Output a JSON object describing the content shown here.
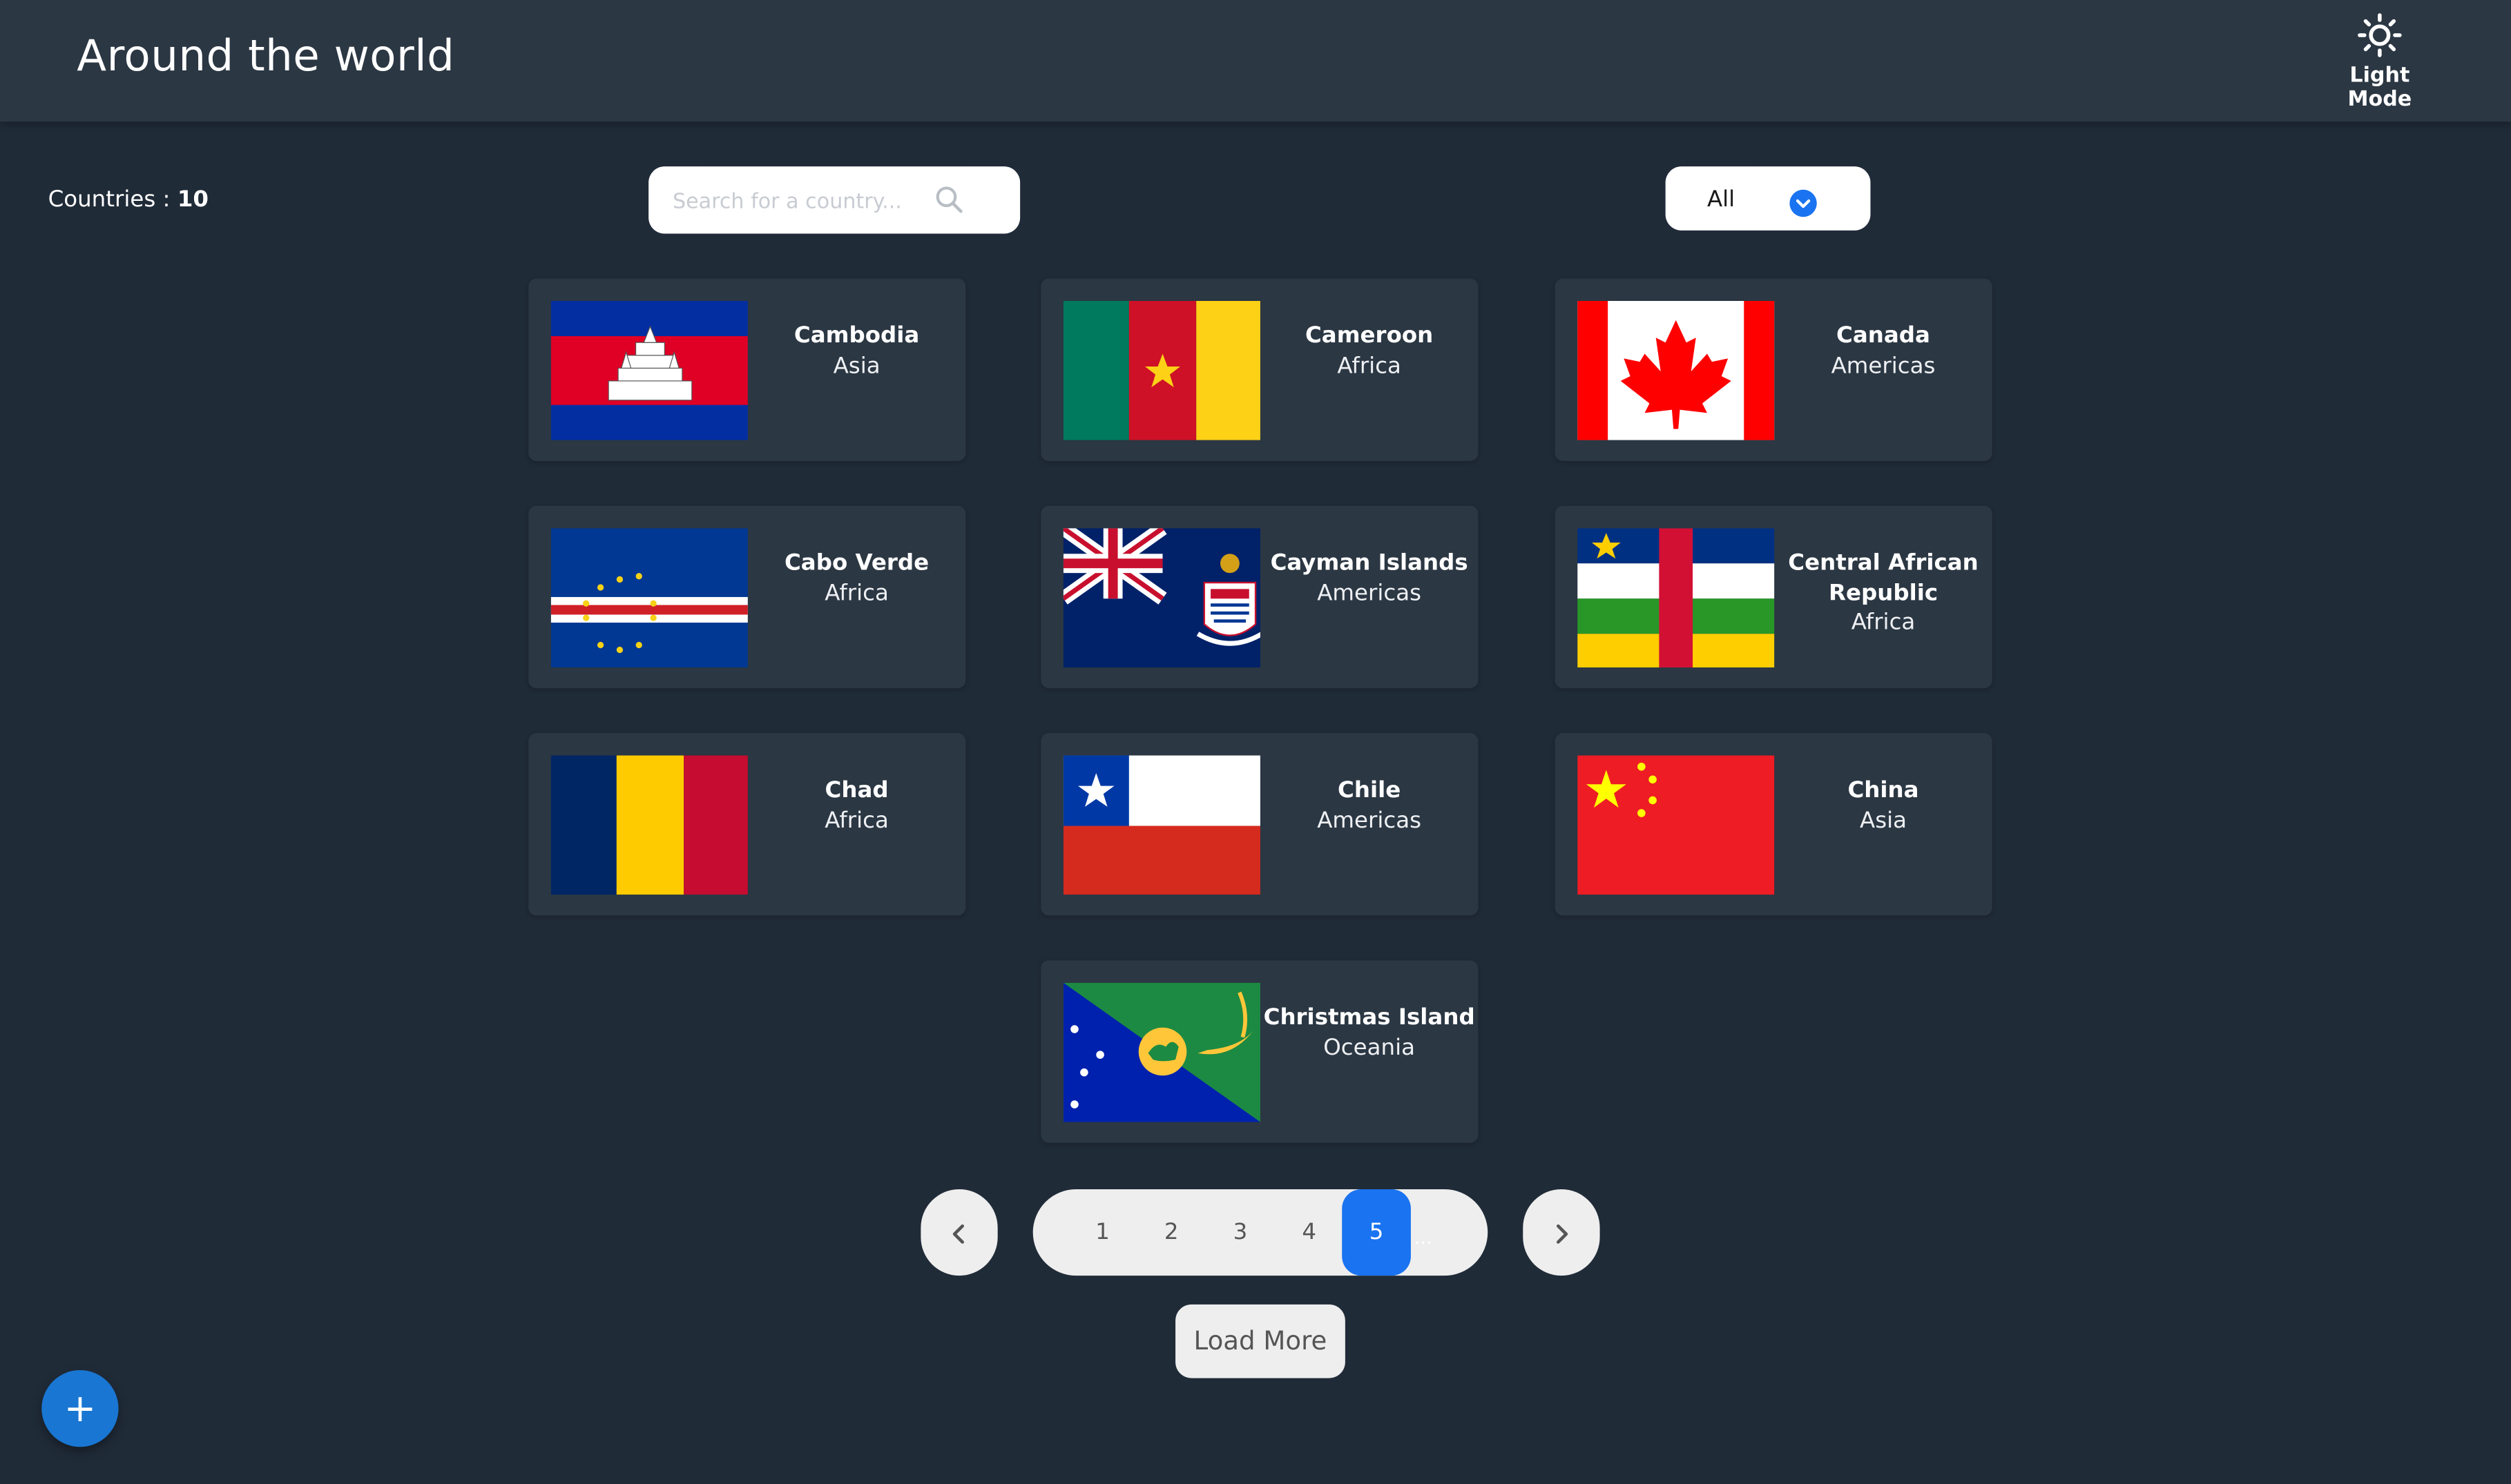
{
  "header": {
    "title": "Around the world",
    "mode_label": "Light Mode",
    "mode_icon": "sun-icon"
  },
  "summary": {
    "label": "Countries : ",
    "count": "10"
  },
  "search": {
    "placeholder": "Search for a country...",
    "value": ""
  },
  "filter": {
    "value": "All"
  },
  "countries": [
    {
      "name": "Cambodia",
      "region": "Asia"
    },
    {
      "name": "Cameroon",
      "region": "Africa"
    },
    {
      "name": "Canada",
      "region": "Americas"
    },
    {
      "name": "Cabo Verde",
      "region": "Africa"
    },
    {
      "name": "Cayman Islands",
      "region": "Americas"
    },
    {
      "name": "Central African Republic",
      "region": "Africa"
    },
    {
      "name": "Chad",
      "region": "Africa"
    },
    {
      "name": "Chile",
      "region": "Americas"
    },
    {
      "name": "China",
      "region": "Asia"
    },
    {
      "name": "Christmas Island",
      "region": "Oceania"
    }
  ],
  "pagination": {
    "prev": "‹",
    "next": "›",
    "pages": [
      "1",
      "2",
      "3",
      "4",
      "5"
    ],
    "current": "5",
    "ellipsis": "..."
  },
  "load_more": "Load More",
  "fab": "+",
  "colors": {
    "background": "#202b38",
    "surface": "#2b3743",
    "accent": "#1a73f0",
    "fab": "#1976d2"
  }
}
